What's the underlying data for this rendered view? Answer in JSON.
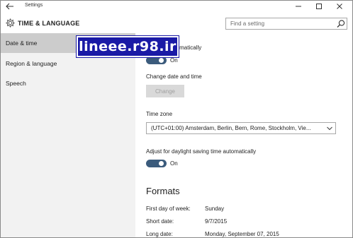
{
  "window": {
    "title": "Settings"
  },
  "header": {
    "section_title": "TIME & LANGUAGE",
    "search_placeholder": "Find a setting"
  },
  "sidebar": {
    "items": [
      {
        "label": "Date & time",
        "active": true
      },
      {
        "label": "Region & language",
        "active": false
      },
      {
        "label": "Speech",
        "active": false
      }
    ]
  },
  "watermark": {
    "text": "lineee.r98.ir"
  },
  "main": {
    "set_time_auto": {
      "label": "Set time automatically",
      "state": "On"
    },
    "change_date": {
      "label": "Change date and time",
      "button": "Change"
    },
    "time_zone": {
      "label": "Time zone",
      "value": "(UTC+01:00) Amsterdam, Berlin, Bern, Rome, Stockholm, Vie..."
    },
    "daylight": {
      "label": "Adjust for daylight saving time automatically",
      "state": "On"
    },
    "formats": {
      "heading": "Formats",
      "rows": [
        {
          "label": "First day of week:",
          "value": "Sunday"
        },
        {
          "label": "Short date:",
          "value": "9/7/2015"
        },
        {
          "label": "Long date:",
          "value": "Monday, September 07, 2015"
        }
      ]
    }
  },
  "colors": {
    "toggle_on": "#3b5b7c",
    "sidebar_bg": "#f2f2f2",
    "sidebar_active": "#cccccc",
    "watermark_bg": "#1a1aa6"
  }
}
